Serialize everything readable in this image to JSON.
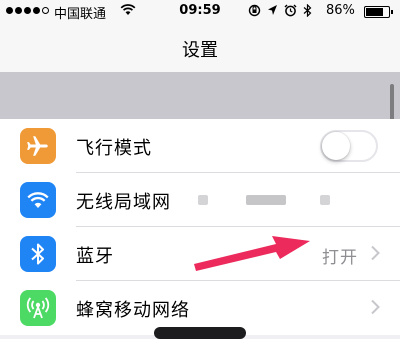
{
  "status_bar": {
    "carrier": "中国联通",
    "time": "09:59",
    "battery_percent": "86%",
    "battery_level": 0.86,
    "signal_bars_filled": 4,
    "signal_bars_total": 5
  },
  "nav": {
    "title": "设置"
  },
  "settings": {
    "airplane": {
      "label": "飞行模式",
      "enabled": false,
      "icon": "airplane-icon",
      "color": "#f09a37"
    },
    "wifi": {
      "label": "无线局域网",
      "icon": "wifi-icon",
      "color": "#1f84f4"
    },
    "bluetooth": {
      "label": "蓝牙",
      "value": "打开",
      "icon": "bluetooth-icon",
      "color": "#1f84f4"
    },
    "cellular": {
      "label": "蜂窝移动网络",
      "icon": "cellular-antenna-icon",
      "color": "#4cd964"
    }
  },
  "annotation": {
    "arrow_color": "#ec2a5c"
  }
}
